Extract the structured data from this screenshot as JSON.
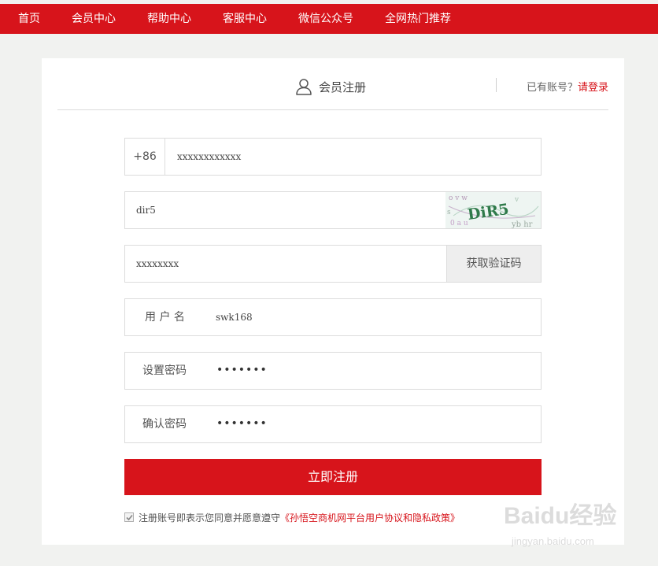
{
  "nav": {
    "items": [
      {
        "label": "首页"
      },
      {
        "label": "会员中心"
      },
      {
        "label": "帮助中心"
      },
      {
        "label": "客服中心"
      },
      {
        "label": "微信公众号"
      },
      {
        "label": "全网热门推荐"
      }
    ]
  },
  "header": {
    "title": "会员注册",
    "has_account_text": "已有账号？",
    "login_link": "请登录"
  },
  "form": {
    "phone_prefix": "+86",
    "phone_value": "xxxxxxxxxxxx",
    "captcha_value": "dir5",
    "captcha_image_text": "DiR5",
    "sms_code_value": "xxxxxxxx",
    "sms_button_label": "获取验证码",
    "username_label": "用 户 名",
    "username_value": "swk168",
    "password_label": "设置密码",
    "password_value": "•••••••",
    "confirm_label": "确认密码",
    "confirm_value": "•••••••",
    "submit_label": "立即注册",
    "agree_text": "注册账号即表示您同意并愿意遵守",
    "policy_link": "《孙悟空商机网平台用户协议和隐私政策》",
    "agree_checked": true
  },
  "watermark": {
    "brand": "Baidu经验",
    "url": "jingyan.baidu.com"
  },
  "colors": {
    "brand_red": "#d7141b",
    "page_bg": "#f1f2f0"
  }
}
